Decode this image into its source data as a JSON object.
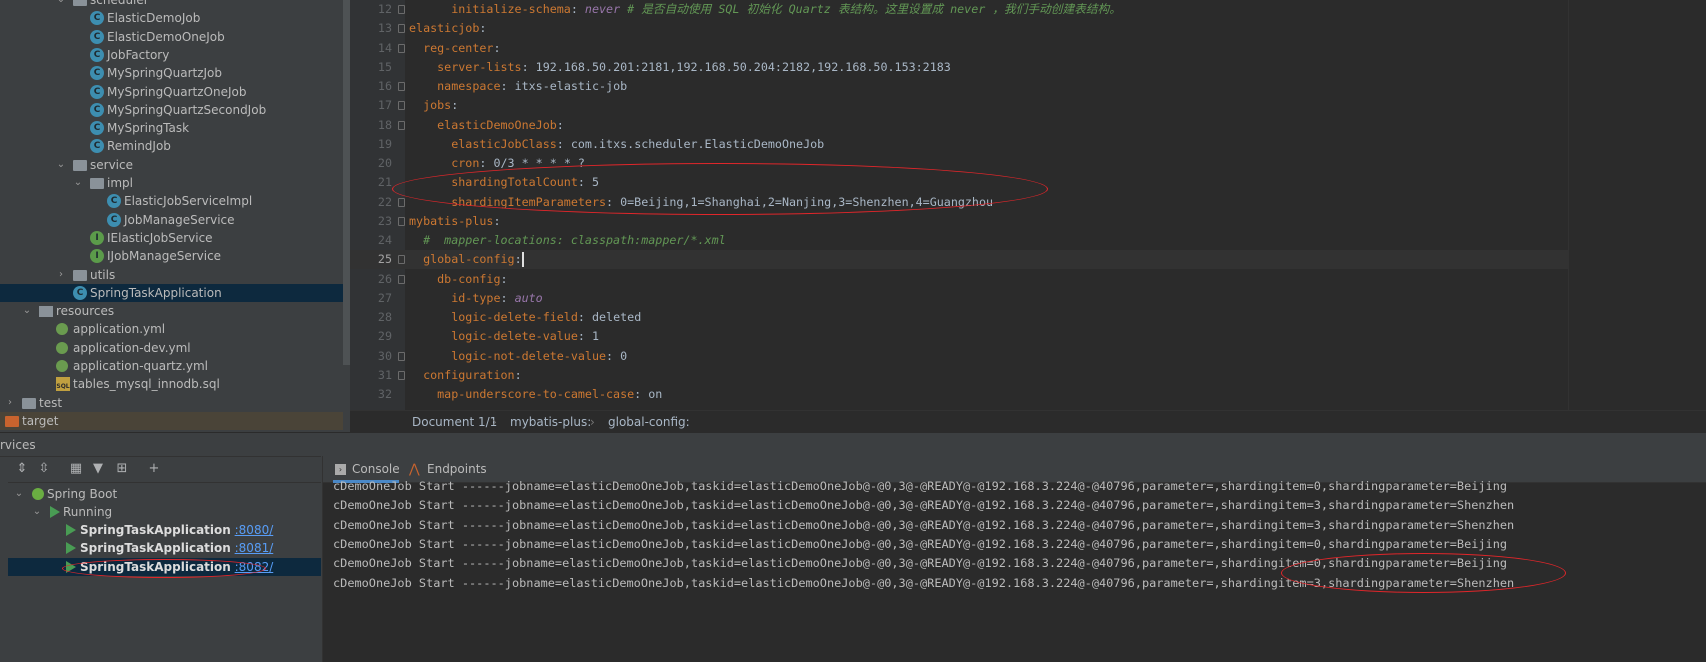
{
  "project_tree": [
    {
      "label": "scheduler",
      "type": "folder",
      "depth": 3,
      "expanded": true
    },
    {
      "label": "ElasticDemoJob",
      "type": "class",
      "depth": 4
    },
    {
      "label": "ElasticDemoOneJob",
      "type": "class",
      "depth": 4
    },
    {
      "label": "JobFactory",
      "type": "class",
      "depth": 4
    },
    {
      "label": "MySpringQuartzJob",
      "type": "class",
      "depth": 4
    },
    {
      "label": "MySpringQuartzOneJob",
      "type": "class",
      "depth": 4
    },
    {
      "label": "MySpringQuartzSecondJob",
      "type": "class",
      "depth": 4
    },
    {
      "label": "MySpringTask",
      "type": "class",
      "depth": 4
    },
    {
      "label": "RemindJob",
      "type": "class",
      "depth": 4
    },
    {
      "label": "service",
      "type": "folder",
      "depth": 3,
      "expanded": true
    },
    {
      "label": "impl",
      "type": "folder",
      "depth": 4,
      "expanded": true
    },
    {
      "label": "ElasticJobServiceImpl",
      "type": "class",
      "depth": 5
    },
    {
      "label": "JobManageService",
      "type": "class",
      "depth": 5
    },
    {
      "label": "IElasticJobService",
      "type": "interface",
      "depth": 4
    },
    {
      "label": "IJobManageService",
      "type": "interface",
      "depth": 4
    },
    {
      "label": "utils",
      "type": "folder",
      "depth": 3,
      "expanded": false
    },
    {
      "label": "SpringTaskApplication",
      "type": "boot",
      "depth": 3,
      "selected": true
    },
    {
      "label": "resources",
      "type": "res",
      "depth": 1,
      "expanded": true
    },
    {
      "label": "application.yml",
      "type": "yml",
      "depth": 2
    },
    {
      "label": "application-dev.yml",
      "type": "yml",
      "depth": 2
    },
    {
      "label": "application-quartz.yml",
      "type": "yml",
      "depth": 2
    },
    {
      "label": "tables_mysql_innodb.sql",
      "type": "sql",
      "depth": 2
    },
    {
      "label": "test",
      "type": "folder",
      "depth": 0,
      "expanded": false
    },
    {
      "label": "target",
      "type": "folder-orange",
      "depth": -1,
      "expanded": false,
      "highlight": true
    }
  ],
  "editor": {
    "current_line": 25,
    "lines": [
      {
        "n": 12,
        "fold": true,
        "segs": [
          [
            "k",
            "      initialize-schema"
          ],
          [
            "p",
            ": "
          ],
          [
            "kw",
            "never"
          ],
          [
            "c",
            " # 是否自动使用 SQL 初始化 Quartz 表结构。这里设置成 never ，我们手动创建表结构。"
          ]
        ]
      },
      {
        "n": 13,
        "fold": true,
        "segs": [
          [
            "k",
            "elasticjob"
          ],
          [
            "p",
            ":"
          ]
        ]
      },
      {
        "n": 14,
        "fold": true,
        "segs": [
          [
            "k",
            "  reg-center"
          ],
          [
            "p",
            ":"
          ]
        ]
      },
      {
        "n": 15,
        "segs": [
          [
            "k",
            "    server-lists"
          ],
          [
            "p",
            ": "
          ],
          [
            "v",
            "192.168.50.201:2181,192.168.50.204:2182,192.168.50.153:2183"
          ]
        ]
      },
      {
        "n": 16,
        "fold": true,
        "segs": [
          [
            "k",
            "    namespace"
          ],
          [
            "p",
            ": "
          ],
          [
            "v",
            "itxs-elastic-job"
          ]
        ]
      },
      {
        "n": 17,
        "fold": true,
        "segs": [
          [
            "k",
            "  jobs"
          ],
          [
            "p",
            ":"
          ]
        ]
      },
      {
        "n": 18,
        "fold": true,
        "segs": [
          [
            "k",
            "    elasticDemoOneJob"
          ],
          [
            "p",
            ":"
          ]
        ]
      },
      {
        "n": 19,
        "segs": [
          [
            "k",
            "      elasticJobClass"
          ],
          [
            "p",
            ": "
          ],
          [
            "v",
            "com.itxs.scheduler.ElasticDemoOneJob"
          ]
        ]
      },
      {
        "n": 20,
        "segs": [
          [
            "k",
            "      cron"
          ],
          [
            "p",
            ": "
          ],
          [
            "v",
            "0/3 * * * * ?"
          ]
        ]
      },
      {
        "n": 21,
        "segs": [
          [
            "k",
            "      shardingTotalCount"
          ],
          [
            "p",
            ": "
          ],
          [
            "v",
            "5"
          ]
        ]
      },
      {
        "n": 22,
        "fold": true,
        "segs": [
          [
            "k",
            "      shardingItemParameters"
          ],
          [
            "p",
            ": "
          ],
          [
            "v",
            "0=Beijing,1=Shanghai,2=Nanjing,3=Shenzhen,4=Guangzhou"
          ]
        ]
      },
      {
        "n": 23,
        "fold": true,
        "segs": [
          [
            "k",
            "mybatis-plus"
          ],
          [
            "p",
            ":"
          ]
        ]
      },
      {
        "n": 24,
        "segs": [
          [
            "c",
            "  #  mapper-locations: classpath:mapper/*.xml"
          ]
        ]
      },
      {
        "n": 25,
        "fold": true,
        "segs": [
          [
            "k",
            "  global-config"
          ],
          [
            "p",
            ":"
          ]
        ]
      },
      {
        "n": 26,
        "fold": true,
        "segs": [
          [
            "k",
            "    db-config"
          ],
          [
            "p",
            ":"
          ]
        ]
      },
      {
        "n": 27,
        "segs": [
          [
            "k",
            "      id-type"
          ],
          [
            "p",
            ": "
          ],
          [
            "kw",
            "auto"
          ]
        ]
      },
      {
        "n": 28,
        "segs": [
          [
            "k",
            "      logic-delete-field"
          ],
          [
            "p",
            ": "
          ],
          [
            "v",
            "deleted"
          ]
        ]
      },
      {
        "n": 29,
        "segs": [
          [
            "k",
            "      logic-delete-value"
          ],
          [
            "p",
            ": "
          ],
          [
            "v",
            "1"
          ]
        ]
      },
      {
        "n": 30,
        "fold": true,
        "segs": [
          [
            "k",
            "      logic-not-delete-value"
          ],
          [
            "p",
            ": "
          ],
          [
            "v",
            "0"
          ]
        ]
      },
      {
        "n": 31,
        "fold": true,
        "segs": [
          [
            "k",
            "  configuration"
          ],
          [
            "p",
            ":"
          ]
        ]
      },
      {
        "n": 32,
        "segs": [
          [
            "k",
            "    map-underscore-to-camel-case"
          ],
          [
            "p",
            ": "
          ],
          [
            "v",
            "on"
          ]
        ]
      }
    ]
  },
  "breadcrumb": [
    "Document 1/1",
    "mybatis-plus:",
    "global-config:"
  ],
  "services": {
    "title": "rvices",
    "toolbar": [
      "expand-all",
      "collapse-all",
      "group",
      "filter",
      "new-service",
      "add"
    ],
    "tree": {
      "root": "Spring Boot",
      "group": "Running",
      "apps": [
        {
          "name": "SpringTaskApplication",
          "port": ":8080/"
        },
        {
          "name": "SpringTaskApplication",
          "port": ":8081/"
        },
        {
          "name": "SpringTaskApplication",
          "port": ":8082/",
          "selected": true
        }
      ]
    }
  },
  "console": {
    "tabs": [
      "Console",
      "Endpoints"
    ],
    "active_tab": "Console",
    "lines": [
      "cDemoOneJob Start ------jobname=elasticDemoOneJob,taskid=elasticDemoOneJob@-@0,3@-@READY@-@192.168.3.224@-@40796,parameter=,shardingitem=0,shardingparameter=Beijing",
      "cDemoOneJob Start ------jobname=elasticDemoOneJob,taskid=elasticDemoOneJob@-@0,3@-@READY@-@192.168.3.224@-@40796,parameter=,shardingitem=3,shardingparameter=Shenzhen",
      "cDemoOneJob Start ------jobname=elasticDemoOneJob,taskid=elasticDemoOneJob@-@0,3@-@READY@-@192.168.3.224@-@40796,parameter=,shardingitem=3,shardingparameter=Shenzhen",
      "cDemoOneJob Start ------jobname=elasticDemoOneJob,taskid=elasticDemoOneJob@-@0,3@-@READY@-@192.168.3.224@-@40796,parameter=,shardingitem=0,shardingparameter=Beijing",
      "cDemoOneJob Start ------jobname=elasticDemoOneJob,taskid=elasticDemoOneJob@-@0,3@-@READY@-@192.168.3.224@-@40796,parameter=,shardingitem=0,shardingparameter=Beijing",
      "cDemoOneJob Start ------jobname=elasticDemoOneJob,taskid=elasticDemoOneJob@-@0,3@-@READY@-@192.168.3.224@-@40796,parameter=,shardingitem=3,shardingparameter=Shenzhen"
    ]
  },
  "colors": {
    "annotation": "#e0262a",
    "selection": "#0d293e",
    "yaml_key": "#cc7832",
    "comment": "#629755",
    "link": "#589df6"
  }
}
